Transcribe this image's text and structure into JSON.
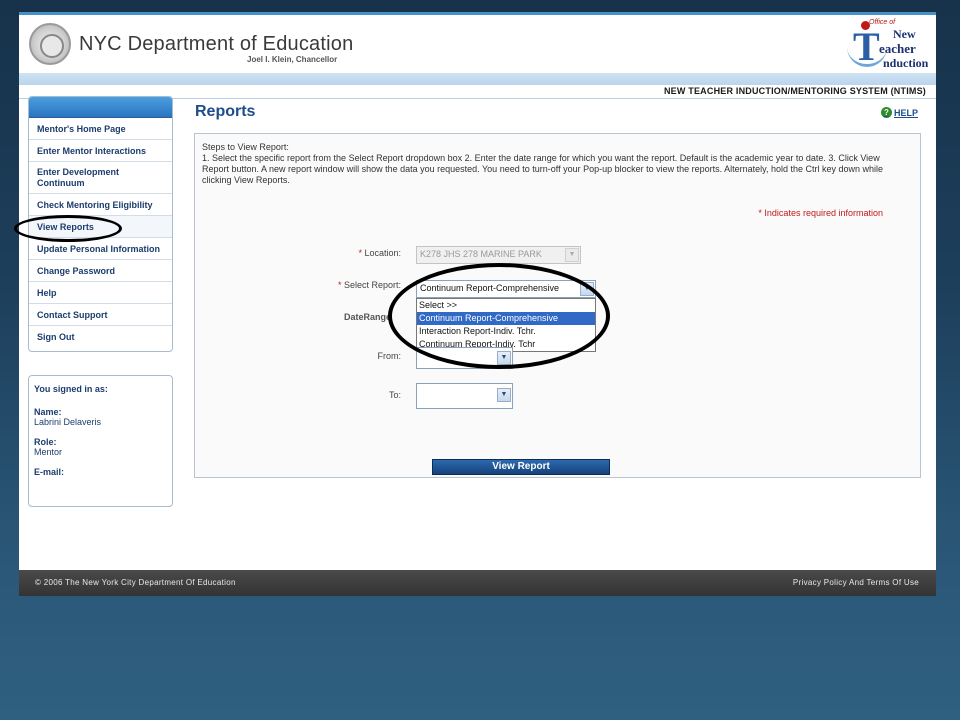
{
  "header": {
    "brand_title": "NYC Department of Education",
    "brand_subtitle": "Joel I. Klein, Chancellor",
    "logo": {
      "office": "Office of",
      "word1": "New",
      "word2": "eacher",
      "word3": "nduction"
    },
    "system_name": "NEW TEACHER INDUCTION/MENTORING SYSTEM (NTIMS)"
  },
  "sidebar": {
    "items": [
      {
        "label": "Mentor's Home Page"
      },
      {
        "label": "Enter Mentor Interactions"
      },
      {
        "label": "Enter Development Continuum"
      },
      {
        "label": "Check Mentoring Eligibility"
      },
      {
        "label": "View Reports"
      },
      {
        "label": "Update Personal Information"
      },
      {
        "label": "Change Password"
      },
      {
        "label": "Help"
      },
      {
        "label": "Contact Support"
      },
      {
        "label": "Sign Out"
      }
    ]
  },
  "user": {
    "signed_in_label": "You signed in as:",
    "name_label": "Name:",
    "name": "Labrini Delaveris",
    "role_label": "Role:",
    "role": "Mentor",
    "email_label": "E-mail:"
  },
  "main": {
    "title": "Reports",
    "help_label": "HELP",
    "steps": "Steps to View Report:\n1. Select the specific report from the Select Report dropdown box 2. Enter the date range for which you want the report. Default is the academic year to date. 3. Click View Report button. A new report window will show the data you requested. You need to turn-off your Pop-up blocker to view the reports. Alternately, hold the Ctrl key down while clicking View Reports.",
    "required_note": "Indicates required information",
    "star": "*",
    "location_label": "Location:",
    "location_value": "K278 JHS 278 MARINE PARK",
    "select_report_label": "Select Report:",
    "select_report_value": "Continuum Report-Comprehensive",
    "report_options": [
      {
        "label": "Select >>",
        "selected": false
      },
      {
        "label": "Continuum Report-Comprehensive",
        "selected": true
      },
      {
        "label": "Interaction Report-Indiv. Tchr.",
        "selected": false
      },
      {
        "label": "Continuum Report-Indiv. Tchr",
        "selected": false
      }
    ],
    "date_range_label": "DateRange",
    "from_label": "From:",
    "to_label": "To:",
    "view_report_label": "View Report"
  },
  "footer": {
    "copyright": "© 2006 The New York City Department Of Education",
    "privacy": "Privacy Policy And Terms Of Use"
  },
  "colors": {
    "accent": "#1c4d8c",
    "required": "#c11a1a",
    "selected_option": "#3169c6"
  }
}
